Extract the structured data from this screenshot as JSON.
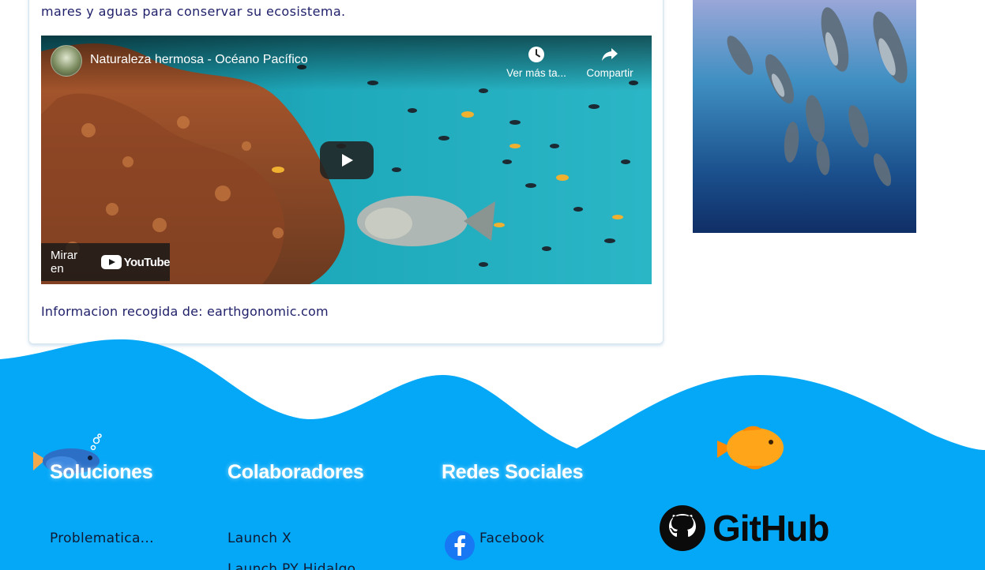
{
  "article": {
    "intro_tail": "mares y aguas para conservar su ecosistema.",
    "source_text": "Informacion recogida de: earthgonomic.com"
  },
  "video": {
    "title": "Naturaleza hermosa - Océano Pacífico",
    "watch_later": "Ver más ta...",
    "share": "Compartir",
    "watch_on": "Mirar en",
    "brand": "YouTube"
  },
  "footer": {
    "columns": [
      {
        "title": "Soluciones",
        "links": [
          "Problematica..."
        ]
      },
      {
        "title": "Colaboradores",
        "links": [
          "Launch X",
          "Launch PY Hidalgo"
        ]
      },
      {
        "title": "Redes Sociales",
        "links": [
          "Facebook"
        ]
      }
    ],
    "github_label": "GitHub"
  },
  "colors": {
    "footer_wave": "#05a8f7",
    "text_dark_blue": "#1f1f6a",
    "footer_title": "#ffffff"
  },
  "icons": [
    "clock-icon",
    "share-icon",
    "play-icon",
    "youtube-logo-icon",
    "facebook-icon",
    "github-icon",
    "fish-icon"
  ]
}
